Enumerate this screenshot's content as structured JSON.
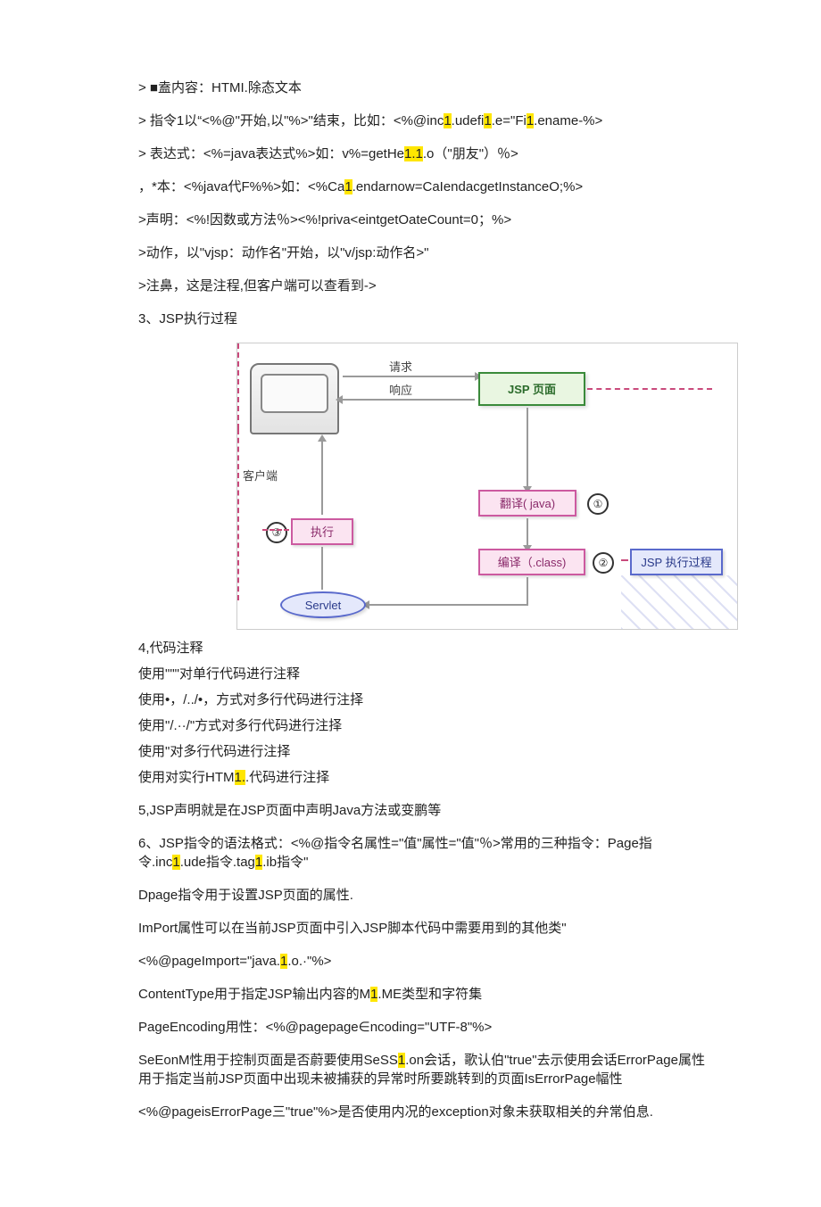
{
  "lines": {
    "l1_a": "> ■盍内容：HTMI.除态文本",
    "l2_a": "> 指令1以“<%@\"开始,以\"%>\"结束，比如：<%@inc",
    "l2_b": ".udefi",
    "l2_c": ".e=\"Fi",
    "l2_d": ".ename-%>",
    "l3_a": "> 表达式：<%=java表达式%>如：v%=getHe",
    "l3_b": ".o（\"朋友\"）％>",
    "l4_a": "，*本：<%java代F%%>如：<%Ca",
    "l4_b": ".endarnow=CaIendacgetInstanceO;%>",
    "l5": ">声明：<%!因数或方法％><%!priva<eintgetOateCount=0；%>",
    "l6": ">动作，以\"vjsp：动作名\"开始，以\"v/jsp:动作名>\"",
    "l7": ">注鼻，这是注程,但客户端可以查看到->",
    "l8": "3、JSP执行过程",
    "l9": "4,代码注释",
    "l10": "使用\"\"\"对单行代码进行注释",
    "l11": "使用•，/../•，方式对多行代码进行注择",
    "l12": "使用\"/.··/\"方式对多行代码进行注择",
    "l13": "使用\"对多行代码进行注择",
    "l14_a": "使用对实行HTM",
    "l14_b": ".代码进行注择",
    "l15": "5,JSP声明就是在JSP页面中声明Java方法或变鹏等",
    "l16_a": "6、JSP指令的语法格式：<%@指令名属性=\"值\"属性=\"值\"％>常用的三种指令：Page指令.inc",
    "l16_b": ".ude指令.tag",
    "l16_c": ".ib指令\"",
    "l17": "Dpage指令用于设置JSP页面的属性.",
    "l18": "ImPort属性可以在当前JSP页面中引入JSP脚本代码中需要用到的其他类\"",
    "l19_a": "<%@pageImport=\"java.",
    "l19_b": ".o.·\"%>",
    "l20_a": "ContentType用于指定JSP输出内容的M",
    "l20_b": ".ME类型和字符集",
    "l21": "PageEncoding用性：<%@pagepage∈ncoding=\"UTF-8\"%>",
    "l22_a": "SeEonM性用于控制页面是否蔚要使用SeSS",
    "l22_b": ".on会话，歌认伯\"true\"去示使用会话ErrorPage属性用于指定当前JSP页面中出现未被捕获的异常时所要跳转到的页面IsErrorPage幅性",
    "l23": "<%@pageisErrorPage三\"true\"%>是否使用内况的exception对象未获取相关的弁常伯息."
  },
  "hl": {
    "one": "1",
    "oneone": "1.1",
    "onedot": "1."
  },
  "diagram": {
    "request": "请求",
    "response": "响应",
    "jspPage": "JSP 页面",
    "client": "客户端",
    "translate": "翻译( java)",
    "compile": "编译（.class)",
    "execute": "执行",
    "servlet": "Servlet",
    "process": "JSP 执行过程",
    "n1": "①",
    "n2": "②",
    "n3": "③"
  }
}
